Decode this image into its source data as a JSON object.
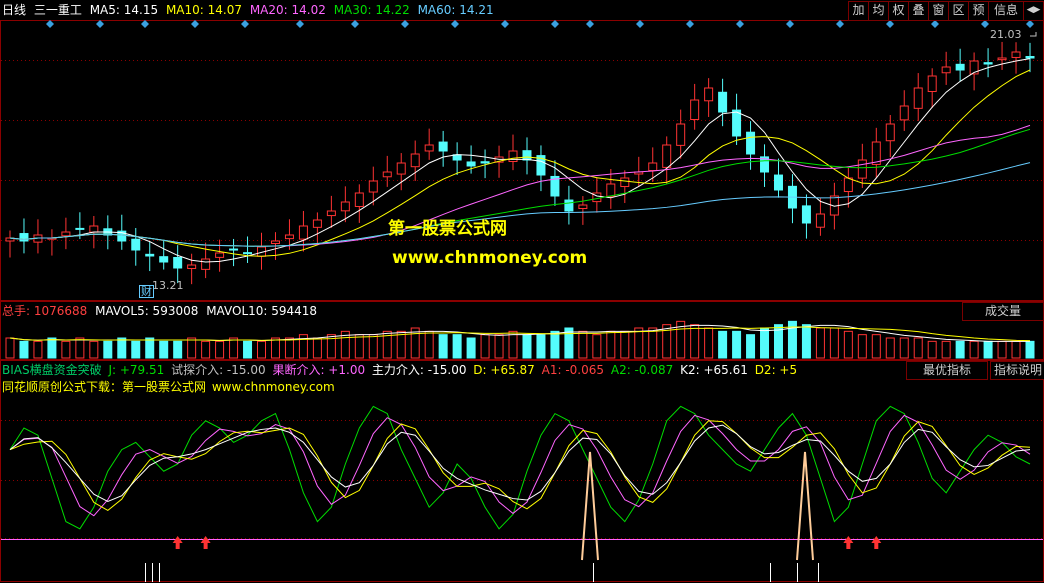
{
  "header": {
    "period": "日线",
    "stock_name": "三一重工",
    "ma": [
      {
        "label": "MA5: 14.15",
        "color": "#ffffff"
      },
      {
        "label": "MA10: 14.07",
        "color": "#ffff00"
      },
      {
        "label": "MA20: 14.02",
        "color": "#ff66ff"
      },
      {
        "label": "MA30: 14.22",
        "color": "#00dd00"
      },
      {
        "label": "MA60: 14.21",
        "color": "#66ccff"
      }
    ]
  },
  "toolbar": [
    "加",
    "均",
    "权",
    "叠",
    "窗",
    "区",
    "预",
    "信息",
    "◀▶"
  ],
  "price_chart": {
    "high_label": "21.03",
    "low_label": "13.21",
    "finance_marker": "财"
  },
  "watermark": {
    "line1": "第一股票公式网",
    "line2": "www.chnmoney.com"
  },
  "volume": {
    "total_label": "总手: 1076688",
    "mavol5_label": "MAVOL5: 593008",
    "mavol10_label": "MAVOL10: 594418",
    "selector": "成交量"
  },
  "indicator": {
    "items": [
      {
        "label": "BIAS横盘资金突破",
        "color": "#00cc66"
      },
      {
        "label": "J: +79.51",
        "color": "#ffffff"
      },
      {
        "label": "试探介入: -15.00",
        "color": "#c0c0c0"
      },
      {
        "label": "果断介入: +1.00",
        "color": "#ff66ff"
      },
      {
        "label": "主力介入: -15.00",
        "color": "#ffffff"
      },
      {
        "label": "D: +65.87",
        "color": "#ffff00"
      },
      {
        "label": "A1: -0.065",
        "color": "#ff4040"
      },
      {
        "label": "A2: -0.087",
        "color": "#00dd00"
      },
      {
        "label": "K2: +65.61",
        "color": "#ffffff"
      },
      {
        "label": "D2: +5",
        "color": "#ffff00"
      }
    ],
    "best_button": "最优指标",
    "help_button": "指标说明",
    "source_text": "同花顺原创公式下载：第一股票公式网",
    "source_url": "www.chnmoney.com"
  },
  "colors": {
    "up": "#ff3333",
    "down": "#54fcfc",
    "grid": "#8b0000",
    "ma5": "#ffffff",
    "ma10": "#ffff00",
    "ma20": "#ff66ff",
    "ma30": "#00dd00",
    "ma60": "#66ccff"
  },
  "chart_data": {
    "type": "candlestick",
    "y_axis_visible_labels": [
      "21.03",
      "13.21"
    ],
    "period_summary": {
      "low": 13.21,
      "high": 21.03,
      "last_close_approx": 20.4
    },
    "close_series_approx": [
      14.4,
      14.3,
      14.5,
      14.4,
      14.6,
      14.7,
      14.8,
      14.5,
      14.3,
      14.0,
      13.8,
      13.6,
      13.4,
      13.5,
      13.7,
      13.9,
      14.0,
      13.9,
      14.1,
      14.3,
      14.5,
      14.8,
      15.0,
      15.3,
      15.6,
      15.9,
      16.3,
      16.6,
      16.9,
      17.2,
      17.5,
      17.3,
      17.0,
      16.8,
      16.9,
      17.1,
      17.3,
      17.0,
      16.5,
      15.8,
      15.3,
      15.5,
      15.9,
      16.2,
      16.4,
      16.6,
      16.9,
      17.5,
      18.2,
      19.0,
      19.4,
      18.6,
      17.8,
      17.2,
      16.6,
      16.0,
      15.4,
      14.9,
      15.2,
      15.8,
      16.4,
      17.0,
      17.6,
      18.2,
      18.8,
      19.4,
      19.8,
      20.1,
      20.0,
      20.3,
      20.2,
      20.4,
      20.6,
      20.4
    ],
    "volume_series_approx": [
      0.6,
      0.5,
      0.5,
      0.6,
      0.5,
      0.6,
      0.5,
      0.5,
      0.6,
      0.5,
      0.6,
      0.5,
      0.5,
      0.6,
      0.5,
      0.5,
      0.6,
      0.5,
      0.5,
      0.6,
      0.6,
      0.7,
      0.6,
      0.7,
      0.8,
      0.7,
      0.7,
      0.8,
      0.8,
      0.9,
      0.8,
      0.7,
      0.7,
      0.6,
      0.7,
      0.7,
      0.8,
      0.7,
      0.7,
      0.8,
      0.9,
      0.8,
      0.7,
      0.8,
      0.8,
      0.9,
      0.9,
      1.0,
      1.1,
      1.0,
      0.9,
      0.8,
      0.8,
      0.7,
      0.9,
      1.0,
      1.1,
      1.0,
      0.9,
      0.9,
      0.8,
      0.7,
      0.7,
      0.6,
      0.6,
      0.6,
      0.5,
      0.5,
      0.5,
      0.5,
      0.5,
      0.5,
      0.5,
      0.5
    ],
    "bias_j_series_approx": [
      60,
      75,
      70,
      40,
      10,
      5,
      20,
      45,
      60,
      65,
      55,
      45,
      50,
      70,
      80,
      75,
      65,
      70,
      80,
      85,
      60,
      30,
      10,
      20,
      50,
      75,
      90,
      85,
      60,
      40,
      20,
      30,
      50,
      40,
      20,
      5,
      15,
      45,
      70,
      85,
      80,
      60,
      40,
      20,
      10,
      25,
      50,
      80,
      90,
      85,
      70,
      60,
      50,
      45,
      60,
      75,
      85,
      70,
      40,
      10,
      20,
      50,
      80,
      90,
      85,
      65,
      40,
      30,
      45,
      60,
      70,
      65,
      55,
      50
    ],
    "signal_arrow_indices": [
      12,
      14,
      60,
      62
    ]
  }
}
